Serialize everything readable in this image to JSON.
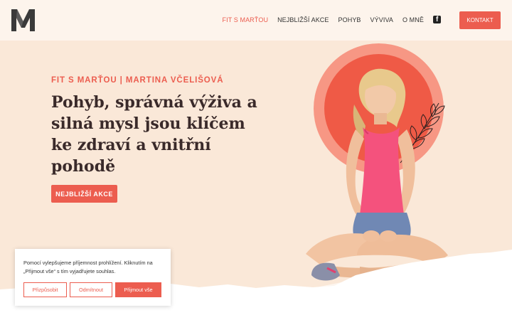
{
  "brand": {
    "logo_letter": "M",
    "accent": "#ec5d4f"
  },
  "nav": {
    "items": [
      {
        "label": "FIT S MARŤOU",
        "active": true
      },
      {
        "label": "NEJBLIŽŠÍ AKCE",
        "active": false
      },
      {
        "label": "POHYB",
        "active": false
      },
      {
        "label": "VÝVIVA",
        "active": false
      },
      {
        "label": "O MNĚ",
        "active": false
      }
    ],
    "social_icon": "facebook-icon",
    "contact_label": "KONTAKT"
  },
  "hero": {
    "subtitle": "FIT S MARŤOU | MARTINA VČELIŠOVÁ",
    "headline": "Pohyb, správná výživa a silná mysl jsou klíčem ke zdraví a vnitřní pohodě",
    "cta_label": "NEJBLIŽŠÍ AKCE"
  },
  "cookie": {
    "text": "Pomocí    vylepšujeme příjemnost prohlížení. Kliknutím na „Přijmout vše“ s tím vyjadřujete souhlas.",
    "customize_label": "Přizpůsobit",
    "reject_label": "Odmítnout",
    "accept_label": "Přijmout vše"
  }
}
